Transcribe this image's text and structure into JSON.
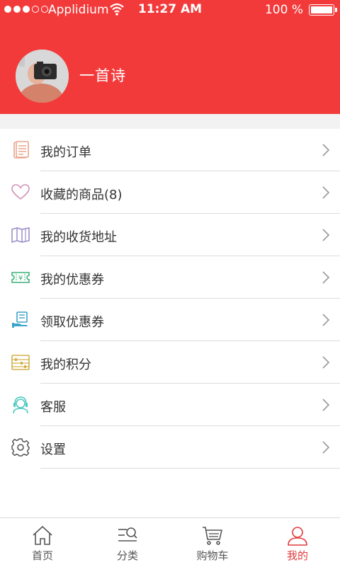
{
  "status_bar": {
    "carrier": "Applidium",
    "time": "11:27 AM",
    "battery": "100 %"
  },
  "profile": {
    "username": "一首诗"
  },
  "menu": {
    "items": [
      {
        "label": "我的订单",
        "icon": "order-list-icon",
        "color": "#e8a58a"
      },
      {
        "label": "收藏的商品(8)",
        "icon": "heart-icon",
        "color": "#d493b8"
      },
      {
        "label": "我的收货地址",
        "icon": "map-icon",
        "color": "#9c8fc8"
      },
      {
        "label": "我的优惠券",
        "icon": "coupon-icon",
        "color": "#3ab27a"
      },
      {
        "label": "领取优惠券",
        "icon": "receive-coupon-icon",
        "color": "#3ba3c8"
      },
      {
        "label": "我的积分",
        "icon": "abacus-icon",
        "color": "#d4b04a"
      },
      {
        "label": "客服",
        "icon": "customer-service-icon",
        "color": "#4cc7c0"
      },
      {
        "label": "设置",
        "icon": "gear-icon",
        "color": "#555555"
      }
    ]
  },
  "tabbar": {
    "tabs": [
      {
        "label": "首页",
        "icon": "home-icon"
      },
      {
        "label": "分类",
        "icon": "category-search-icon"
      },
      {
        "label": "购物车",
        "icon": "cart-icon"
      },
      {
        "label": "我的",
        "icon": "user-icon",
        "active": true
      }
    ]
  },
  "colors": {
    "header": "#f33a3a",
    "active_tab": "#e23a3a"
  }
}
